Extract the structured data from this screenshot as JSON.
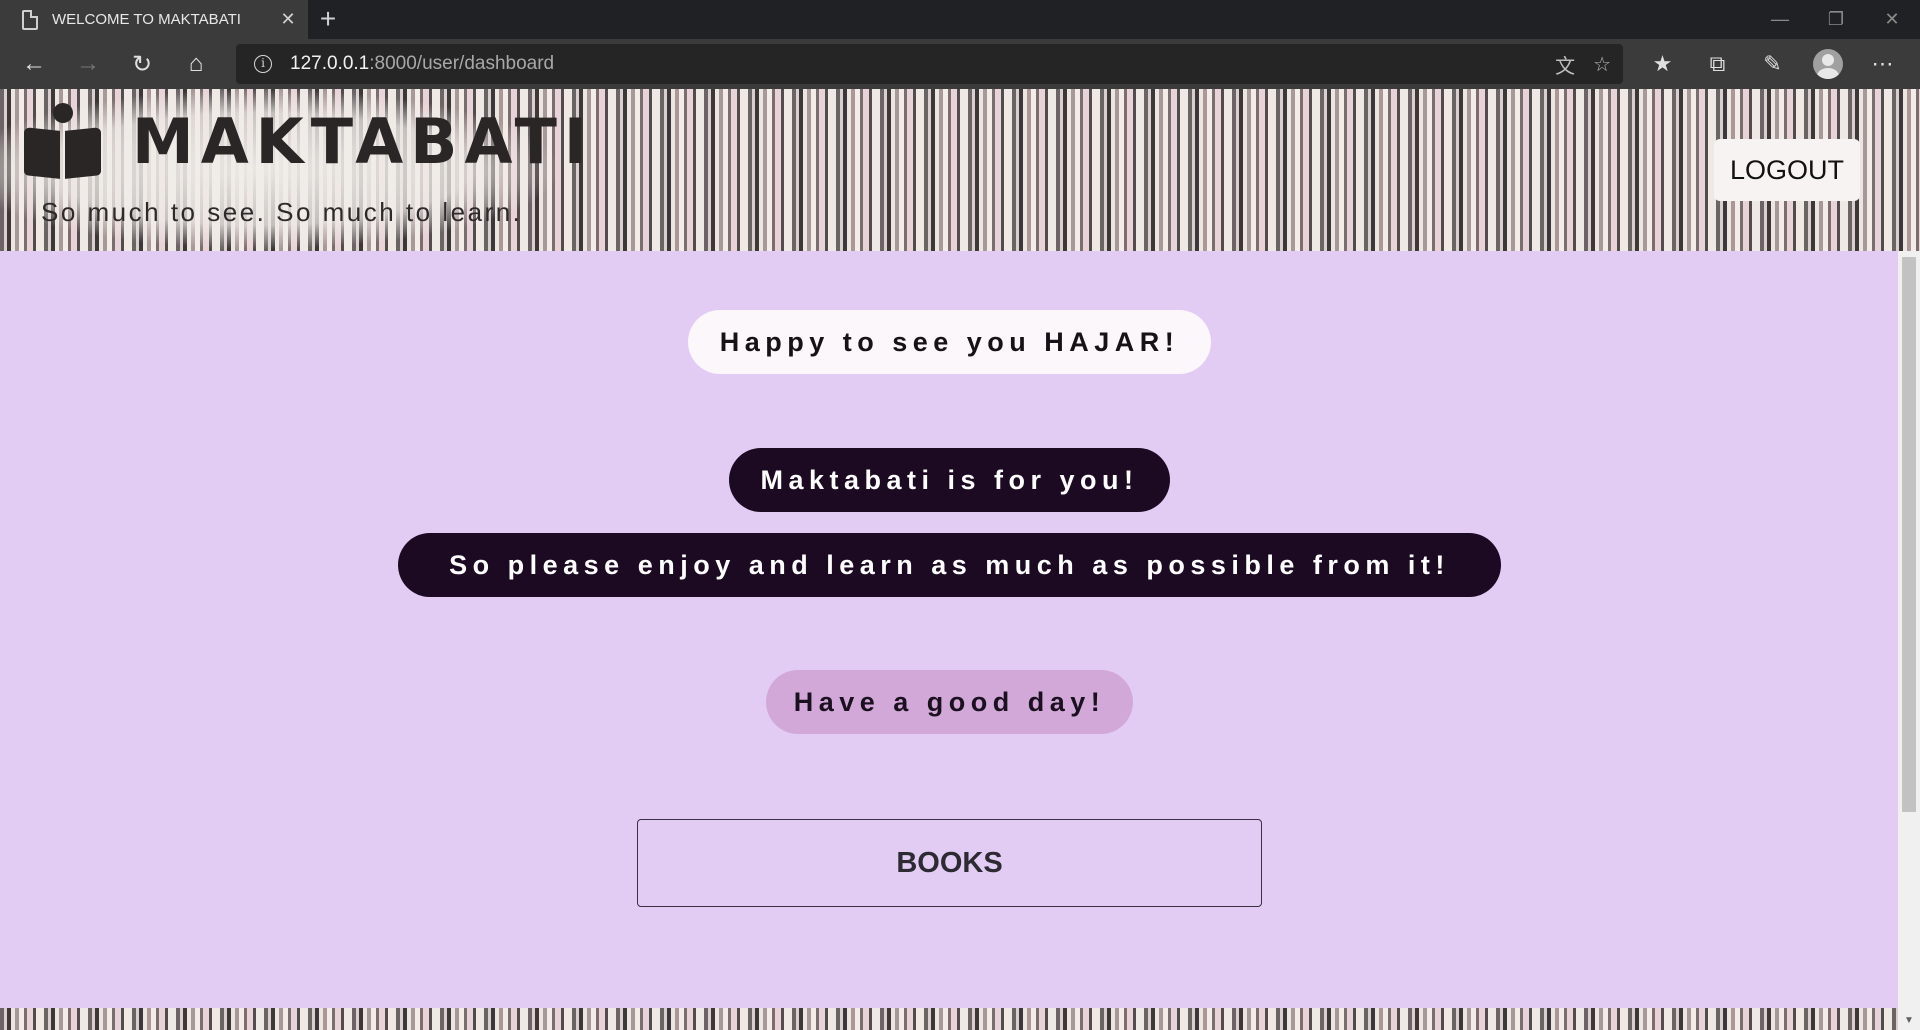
{
  "browser": {
    "tab_title": "WELCOME TO MAKTABATI",
    "tab_close": "✕",
    "new_tab": "+",
    "url_host": "127.0.0.1",
    "url_rest": ":8000/user/dashboard",
    "info_glyph": "i",
    "icons": {
      "back": "back-arrow-icon",
      "forward": "forward-arrow-icon",
      "refresh": "refresh-icon",
      "home": "home-icon",
      "translate": "translate-icon",
      "favorite": "star-icon",
      "favorites": "favorites-list-icon",
      "collections": "collections-icon",
      "feedback": "feedback-icon",
      "profile": "profile-icon",
      "more": "more-icon"
    }
  },
  "header": {
    "brand_name": "MAKTABATI",
    "tagline": "So much to see. So much to learn.",
    "logout_label": "LOGOUT"
  },
  "main": {
    "greeting": "Happy to see you HAJAR!",
    "message_1": "Maktabati is for you!",
    "message_2": "So please enjoy and learn as much as possible from it!",
    "message_3": "Have a good day!",
    "books_label": "BOOKS"
  },
  "colors": {
    "page_background": "#e2ccf4",
    "dark_bubble": "#1b0a22",
    "light_bubble": "#fbf7fa",
    "pink_bubble": "#d2a8d8"
  }
}
